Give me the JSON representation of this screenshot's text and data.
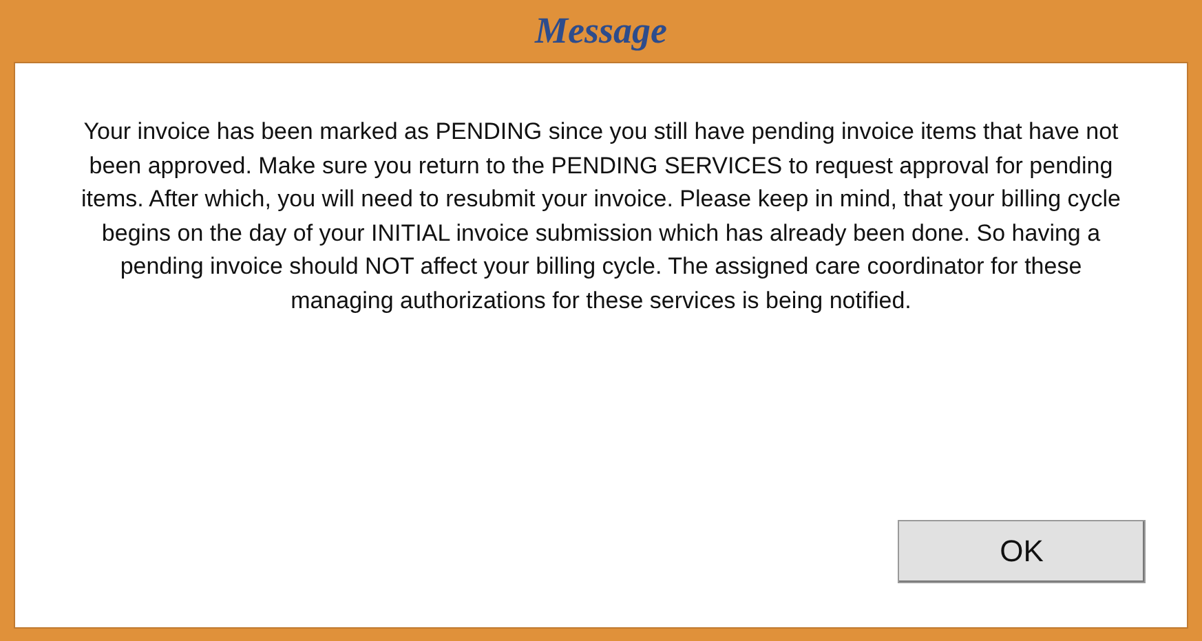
{
  "window": {
    "title": "Message"
  },
  "message": "Your invoice has been marked as PENDING since you still have pending invoice items that have not been approved. Make sure you return to the PENDING SERVICES to request approval for pending items. After which, you will need to resubmit your invoice. Please keep in mind, that your billing cycle begins on the day of your INITIAL invoice submission which has already been done. So having a pending invoice should NOT affect your billing cycle. The assigned care coordinator for these managing authorizations for these services is being notified.",
  "buttons": [
    "OK"
  ]
}
